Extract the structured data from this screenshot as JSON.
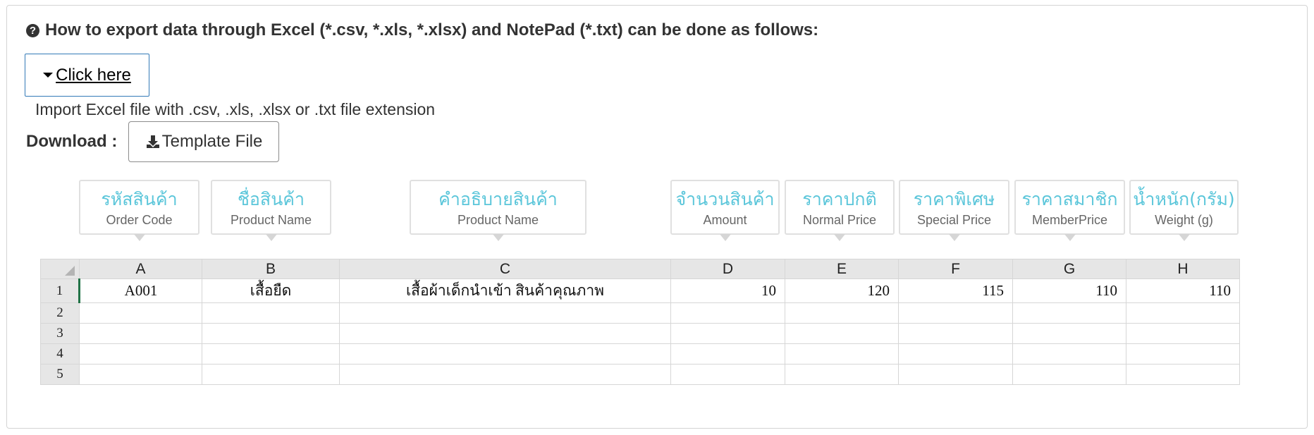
{
  "instructions": {
    "heading_icon": "question-circle-icon",
    "heading": "How to export data through Excel (*.csv, *.xls, *.xlsx) and NotePad (*.txt) can be done as follows:",
    "click_here_label": "Click here",
    "import_note": "Import Excel file with .csv, .xls, .xlsx or .txt file extension",
    "download_label": "Download :",
    "template_button_label": "Template File",
    "accent_color": "#337ab7"
  },
  "callouts": [
    {
      "th": "รหัสสินค้า",
      "en": "Order Code"
    },
    {
      "th": "ชื่อสินค้า",
      "en": "Product Name"
    },
    {
      "th": "คำอธิบายสินค้า",
      "en": "Product Name"
    },
    {
      "th": "จำนวนสินค้า",
      "en": "Amount"
    },
    {
      "th": "ราคาปกติ",
      "en": "Normal Price"
    },
    {
      "th": "ราคาพิเศษ",
      "en": "Special Price"
    },
    {
      "th": "ราคาสมาชิก",
      "en": "MemberPrice"
    },
    {
      "th": "น้ำหนัก(กรัม)",
      "en": "Weight (g)"
    }
  ],
  "callout_color": "#5bc6da",
  "spreadsheet": {
    "columns": [
      "A",
      "B",
      "C",
      "D",
      "E",
      "F",
      "G",
      "H"
    ],
    "rows": [
      "1",
      "2",
      "3",
      "4",
      "5"
    ],
    "row1": [
      "A001",
      "เสื้อยืด",
      "เสื้อผ้าเด็กนำเข้า สินค้าคุณภาพ",
      "10",
      "120",
      "115",
      "110",
      "110"
    ]
  }
}
